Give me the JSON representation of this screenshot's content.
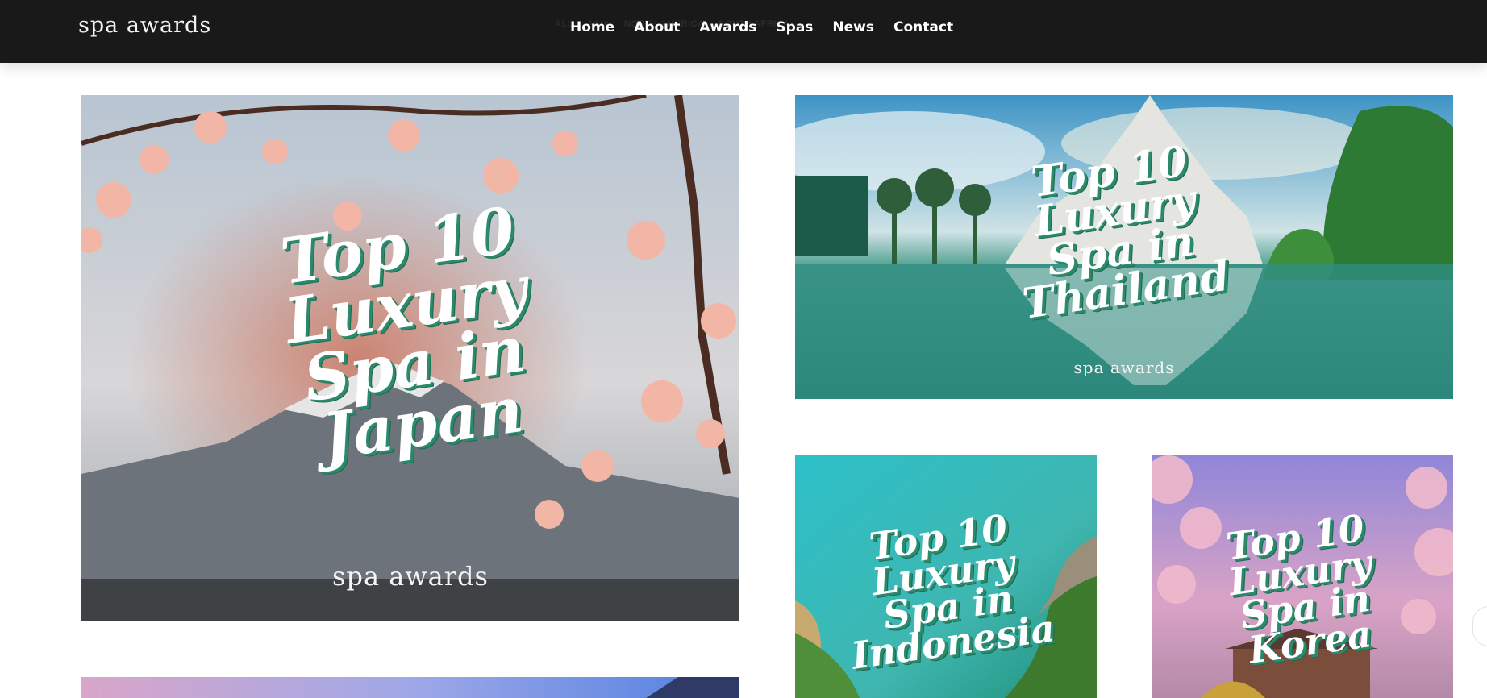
{
  "header": {
    "logo": "spa awards",
    "filter_tags": [
      "ALL",
      "ASIA",
      "NORTH AMERICA",
      "SOUTH AFRICA"
    ],
    "nav": [
      {
        "label": "Home"
      },
      {
        "label": "About"
      },
      {
        "label": "Awards"
      },
      {
        "label": "Spas"
      },
      {
        "label": "News"
      },
      {
        "label": "Contact"
      }
    ]
  },
  "cards": {
    "japan": {
      "lines": [
        "Top 10",
        "Luxury",
        "Spa in",
        "Japan"
      ],
      "brand": "spa awards"
    },
    "thailand": {
      "lines": [
        "Top 10",
        "Luxury",
        "Spa in",
        "Thailand"
      ],
      "brand": "spa awards"
    },
    "indonesia": {
      "lines": [
        "Top 10",
        "Luxury",
        "Spa in",
        "Indonesia"
      ]
    },
    "korea": {
      "lines": [
        "Top 10",
        "Luxury",
        "Spa in",
        "Korea"
      ]
    }
  },
  "colors": {
    "header_bg": "#191919",
    "headline_shadow": "#2b8a6b"
  }
}
